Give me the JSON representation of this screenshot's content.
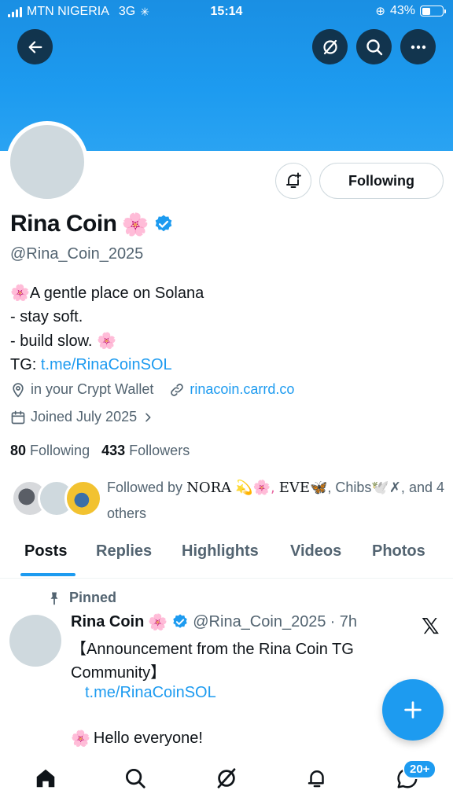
{
  "status_bar": {
    "carrier": "MTN NIGERIA",
    "network": "3G",
    "time": "15:14",
    "battery": "43%",
    "battery_level": 0.43
  },
  "header": {
    "icons": [
      "back-arrow-icon",
      "grok-icon",
      "search-icon",
      "more-icon"
    ]
  },
  "profile": {
    "name": "Rina Coin",
    "name_emoji": "🌸",
    "handle": "@Rina_Coin_2025",
    "bio": {
      "line1": "A gentle place on Solana",
      "line2": "- stay soft.",
      "line3": "- build slow.",
      "tg_label": "TG:",
      "tg_link": "t.me/RinaCoinSOL"
    },
    "location": "in your Crypt Wallet",
    "website": "rinacoin.carrd.co",
    "joined": "Joined July 2025",
    "following_count": "80",
    "following_label": "Following",
    "followers_count": "433",
    "followers_label": "Followers",
    "follow_button": "Following",
    "followed_by_prefix": "Followed by",
    "followed_by_name1": "NORA",
    "followed_by_sep1": "💫🌸,",
    "followed_by_name2": "EVE",
    "followed_by_sep2": "🦋, Chibs🕊️✗,",
    "followed_by_suffix": "and 4 others"
  },
  "tabs": [
    {
      "label": "Posts",
      "active": true
    },
    {
      "label": "Replies"
    },
    {
      "label": "Highlights"
    },
    {
      "label": "Videos"
    },
    {
      "label": "Photos"
    }
  ],
  "post": {
    "pinned_label": "Pinned",
    "name": "Rina Coin",
    "handle": "@Rina_Coin_2025",
    "time": "· 7h",
    "line1": "【Announcement from the Rina Coin TG",
    "line2": "Community】",
    "link": "t.me/RinaCoinSOL",
    "hello": "Hello everyone!"
  },
  "bottom_nav": {
    "icons": [
      "home-icon",
      "search-icon",
      "grok-icon",
      "notifications-icon",
      "messages-icon"
    ],
    "messages_badge": "20+"
  },
  "colors": {
    "accent": "#1d9bf0",
    "banner": "#1d9bf0",
    "secondary_text": "#536471"
  }
}
